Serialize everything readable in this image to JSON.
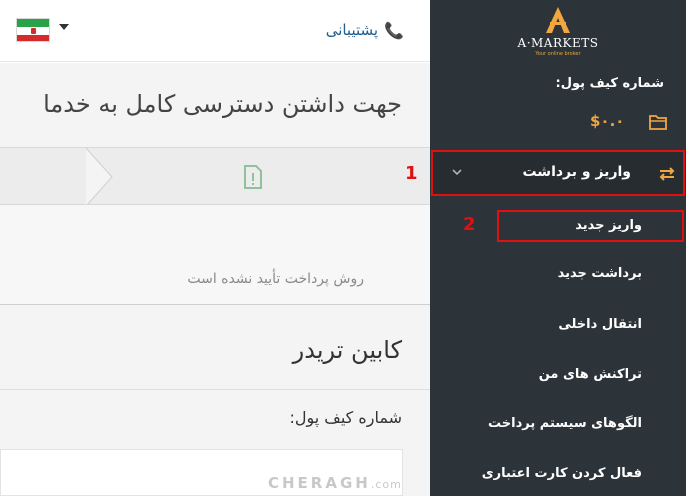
{
  "header": {
    "support_label": "پشتیبانی",
    "flag_icon": "iran-flag-icon",
    "lang_caret_icon": "caret-down-icon"
  },
  "main": {
    "banner_title": "جهت داشتن دسترسی کامل به خدما",
    "method_status": "روش پرداخت تأیید نشده است",
    "cabin_title": "کابین تریدر",
    "wallet_label": "شماره کیف پول:"
  },
  "sidebar": {
    "logo_text": "A·MARKETS",
    "logo_tagline": "Your online broker",
    "wallet_label": "شماره کیف پول:",
    "balance": "$۰.۰",
    "deposit_withdraw": "واریز و برداشت",
    "submenu": [
      "واریز جدید",
      "برداشت جدید",
      "انتقال داخلی",
      "تراکنش های من",
      "الگوهای سیستم پرداخت",
      "فعال کردن کارت اعتباری"
    ]
  },
  "annotations": {
    "step1": "1",
    "step2": "2"
  },
  "watermark": {
    "text": "CHERAGH",
    "suffix": ".com"
  },
  "colors": {
    "sidebar_bg": "#2d3439",
    "accent_orange": "#f2a640",
    "highlight_red": "#e01010",
    "support_blue": "#1f5e8f"
  }
}
